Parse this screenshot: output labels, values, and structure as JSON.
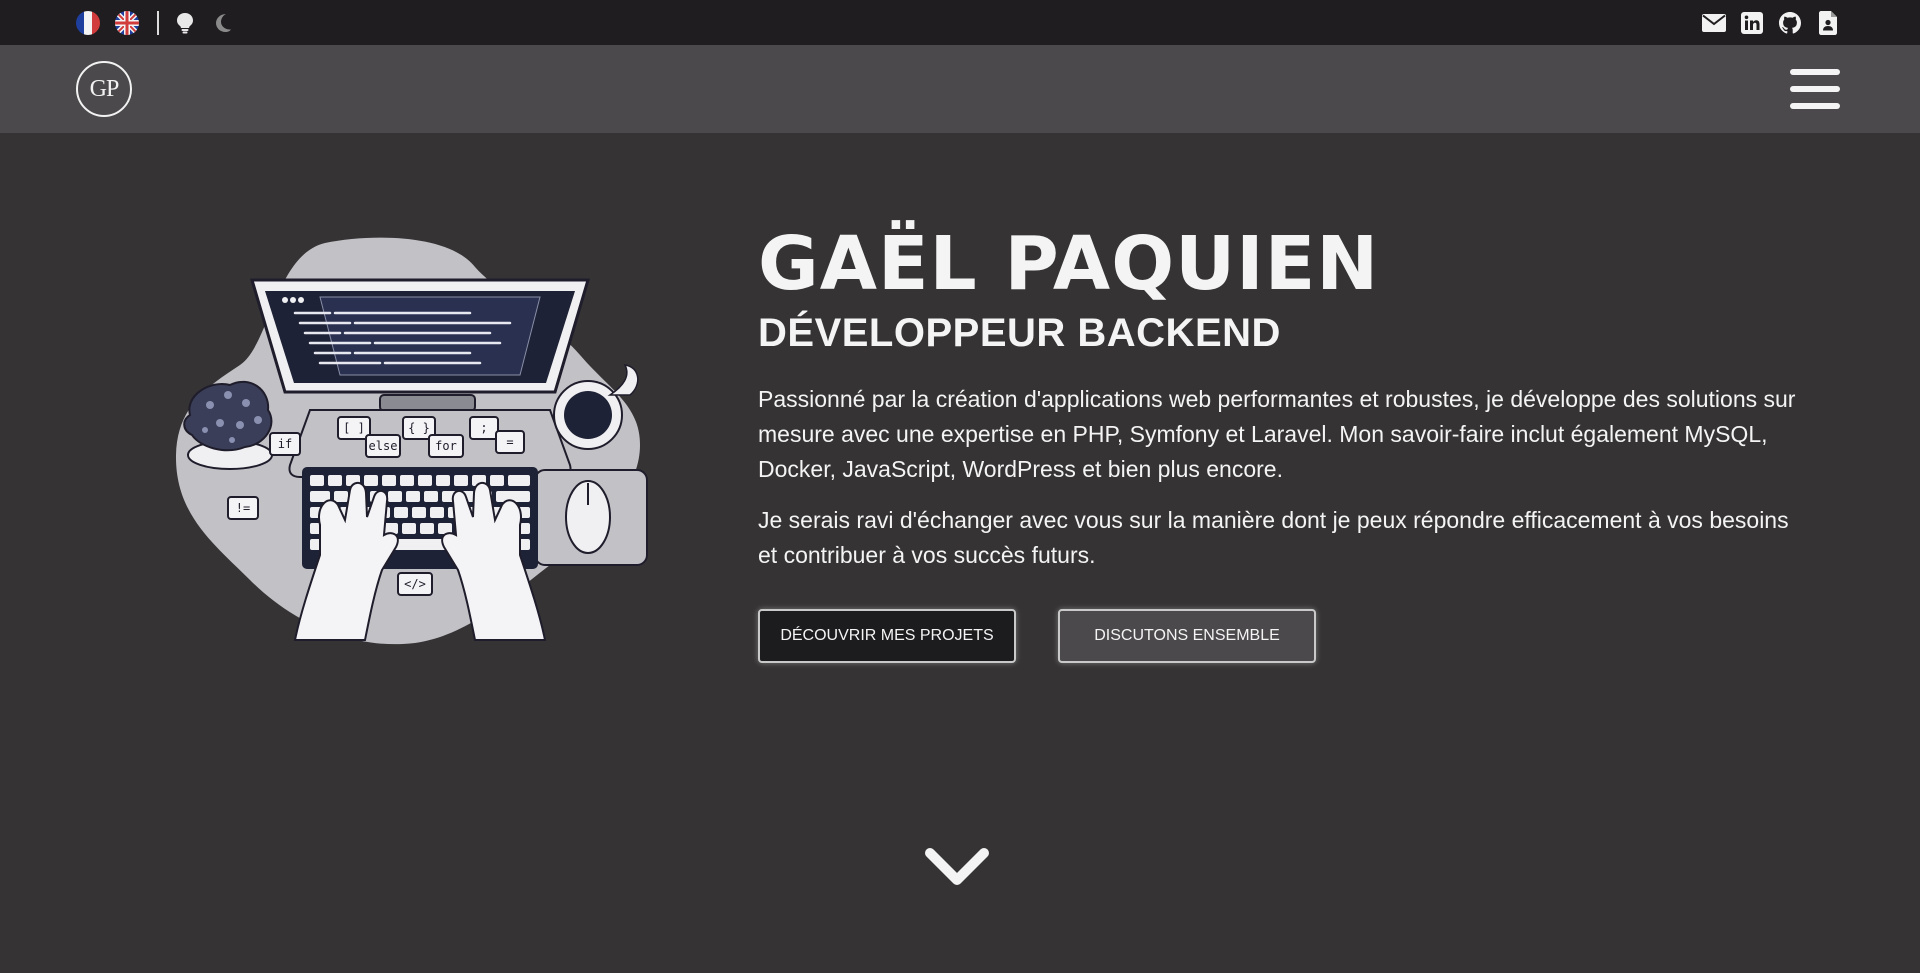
{
  "topbar": {
    "languages": [
      {
        "icon": "flag-fr-icon",
        "colors": [
          "#1f3f9e",
          "#f4f4f4",
          "#d23b3b"
        ]
      },
      {
        "icon": "flag-uk-icon",
        "colors": [
          "#1f3f9e",
          "#f4f4f4",
          "#d23b3b"
        ]
      }
    ],
    "theme_icons": [
      "light-mode-icon",
      "dark-mode-icon"
    ],
    "social_icons": [
      "email-icon",
      "linkedin-icon",
      "github-icon",
      "resume-icon"
    ]
  },
  "navbar": {
    "logo_text": "GP",
    "menu_icon": "hamburger-menu-icon"
  },
  "hero": {
    "name": "GAËL PAQUIEN",
    "role": "DÉVELOPPEUR BACKEND",
    "paragraph_1": "Passionné par la création d'applications web performantes et robustes, je développe des solutions sur mesure avec une expertise en PHP, Symfony et Laravel. Mon savoir-faire inclut également MySQL, Docker, JavaScript, WordPress et bien plus encore.",
    "paragraph_2": "Je serais ravi d'échanger avec vous sur la manière dont je peux répondre efficacement à vos besoins et contribuer à vos succès futurs.",
    "button_primary": "DÉCOUVRIR MES PROJETS",
    "button_secondary": "DISCUTONS ENSEMBLE",
    "illustration": {
      "code_bubbles": [
        "if",
        "[ ]",
        "else",
        "{ }",
        "for",
        ";",
        "=",
        "!=",
        "</>"
      ]
    }
  },
  "scroll_icon": "chevron-down-icon",
  "colors": {
    "background": "#353334",
    "topbar": "#1f1d1f",
    "navbar": "#4b494b",
    "text": "#f4f4f4"
  }
}
